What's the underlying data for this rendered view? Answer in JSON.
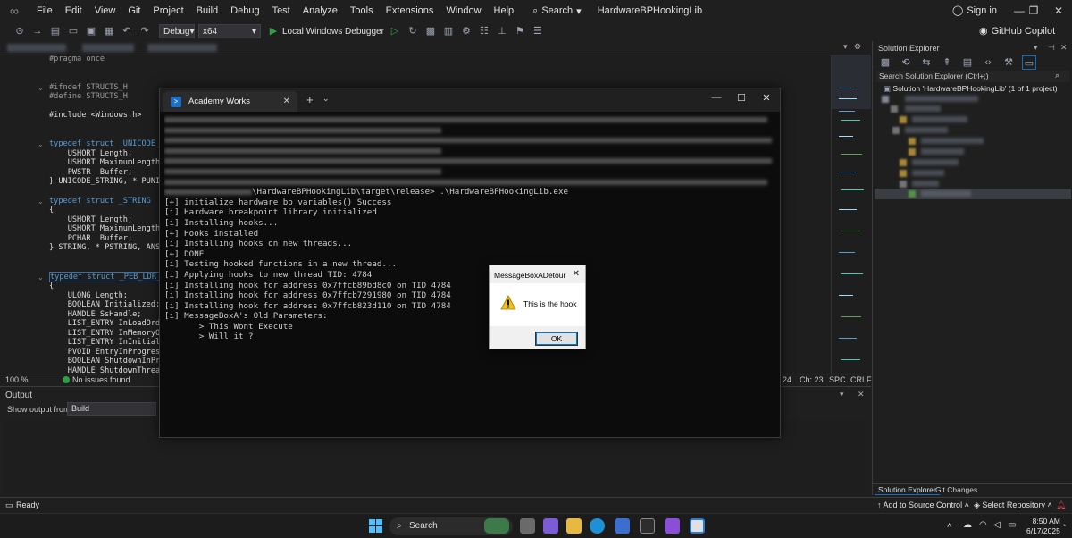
{
  "menubar": {
    "items": [
      "File",
      "Edit",
      "View",
      "Git",
      "Project",
      "Build",
      "Debug",
      "Test",
      "Analyze",
      "Tools",
      "Extensions",
      "Window",
      "Help"
    ],
    "search_label": "Search",
    "solution_name": "HardwareBPHookingLib",
    "signin_label": "Sign in"
  },
  "toolbar": {
    "config": "Debug",
    "platform": "x64",
    "run_label": "Local Windows Debugger",
    "copilot_label": "GitHub Copilot"
  },
  "editor": {
    "lines": [
      "#pragma once",
      "",
      "",
      "#ifndef STRUCTS_H",
      "#define STRUCTS_H",
      "",
      "#include <Windows.h>",
      "",
      "",
      "typedef struct _UNICODE_ST",
      "    USHORT Length;",
      "    USHORT MaximumLength;",
      "    PWSTR  Buffer;",
      "} UNICODE_STRING, * PUNICO",
      "",
      "typedef struct _STRING",
      "{",
      "    USHORT Length;",
      "    USHORT MaximumLength;",
      "    PCHAR  Buffer;",
      "} STRING, * PSTRING, ANSI_",
      "",
      "",
      "typedef struct _PEB_LDR_DA",
      "{",
      "    ULONG Length;",
      "    BOOLEAN Initialized;",
      "    HANDLE SsHandle;",
      "    LIST_ENTRY InLoadOrder",
      "    LIST_ENTRY InMemoryOrd",
      "    LIST_ENTRY InInitializ",
      "    PVOID EntryInProgress;",
      "    BOOLEAN ShutdownInProg",
      "    HANDLE ShutdownThreadI"
    ],
    "zoom": "100 %",
    "issues": "No issues found",
    "ln_col": "24",
    "ch": "Ch: 23",
    "spc": "SPC",
    "crlf": "CRLF"
  },
  "output": {
    "title": "Output",
    "show_from": "Show output from:",
    "source": "Build"
  },
  "solution_explorer": {
    "title": "Solution Explorer",
    "search_placeholder": "Search Solution Explorer (Ctrl+;)",
    "solution_label": "Solution 'HardwareBPHookingLib' (1 of 1 project)",
    "tab_solution": "Solution Explorer",
    "tab_git": "Git Changes"
  },
  "terminal": {
    "tab_title": "Academy Works",
    "prompt_suffix": "\\HardwareBPHookingLib\\target\\release> .\\HardwareBPHookingLib.exe",
    "output_lines": [
      "[+] initialize_hardware_bp_variables() Success",
      "[i] Hardware breakpoint library initialized",
      "[i] Installing hooks...",
      "[+] Hooks installed",
      "[i] Installing hooks on new threads...",
      "[+] DONE",
      "[i] Testing hooked functions in a new thread...",
      "[i] Applying hooks to new thread TID: 4784",
      "[i] Installing hook for address 0x7ffcb89bd8c0 on TID 4784",
      "[i] Installing hook for address 0x7ffcb7291980 on TID 4784",
      "[i] Installing hook for address 0x7ffcb823d110 on TID 4784",
      "[i] MessageBoxA's Old Parameters:",
      "       > This Wont Execute",
      "       > Will it ?"
    ]
  },
  "msgbox": {
    "title": "MessageBoxADetour",
    "text": "This is the hook",
    "ok_label": "OK"
  },
  "statusbar": {
    "ready": "Ready",
    "source_control": "Add to Source Control",
    "repository": "Select Repository"
  },
  "taskbar": {
    "search_label": "Search",
    "time": "8:50 AM",
    "date": "6/17/2025"
  },
  "colors": {
    "vs_background": "#1f1f1f",
    "editor_background": "#1e1e1e",
    "terminal_background": "#0c0c0c",
    "keyword_blue": "#569cd6",
    "accent_blue": "#0e70c0",
    "success_green": "#2ea043"
  }
}
